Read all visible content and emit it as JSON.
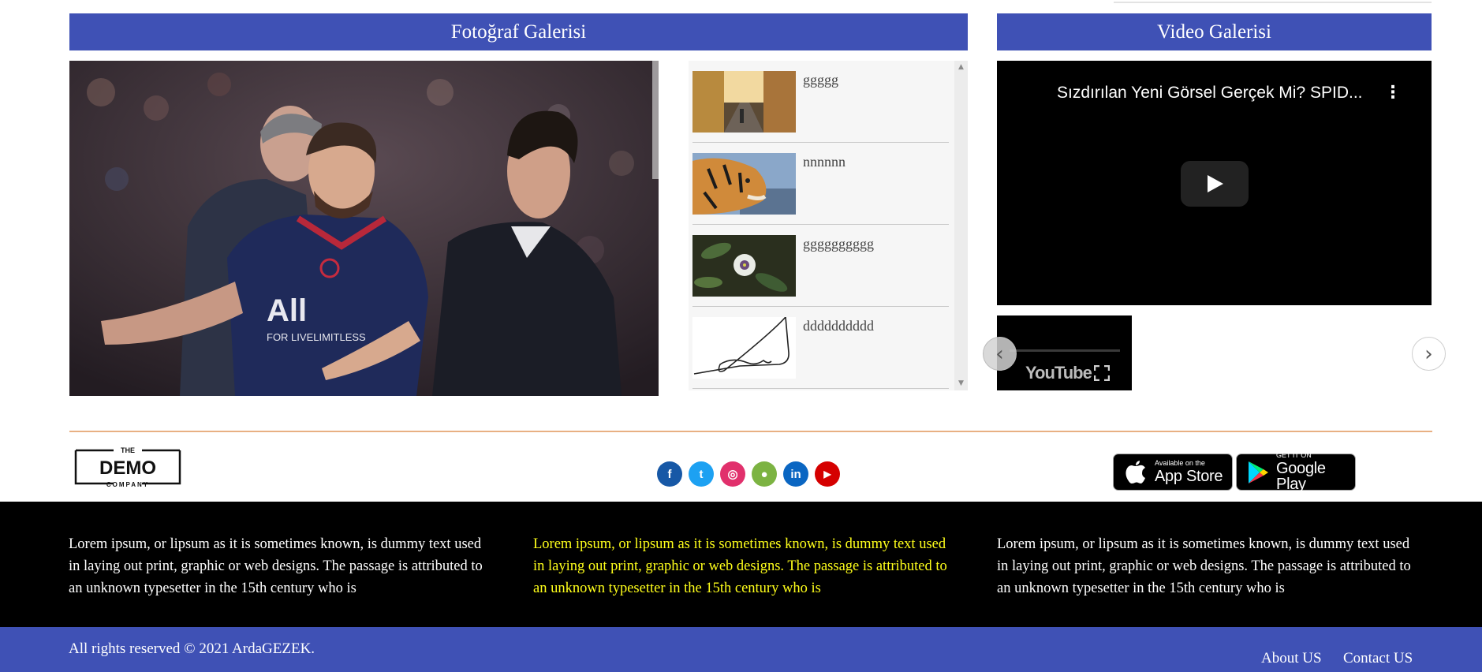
{
  "photo_gallery": {
    "heading": "Fotoğraf Galerisi",
    "thumbnails": [
      {
        "title": "ggggg"
      },
      {
        "title": "nnnnnn"
      },
      {
        "title": "gggggggggg"
      },
      {
        "title": "dddddddddd"
      }
    ],
    "scroll_up": "▲",
    "scroll_down": "▼"
  },
  "video_gallery": {
    "heading": "Video Galerisi",
    "video_title": "Sızdırılan Yeni Görsel Gerçek Mi? SPID...",
    "menu_glyph": "⋮",
    "youtube_label": "YouTube",
    "prev_glyph": "‹",
    "next_glyph": "›"
  },
  "brand": {
    "logo_top": "THE",
    "logo_main": "DEMO",
    "logo_bottom": "COMPANY"
  },
  "social": [
    {
      "name": "facebook",
      "glyph": "f",
      "color": "#1758a6"
    },
    {
      "name": "twitter",
      "glyph": "t",
      "color": "#1da1f2"
    },
    {
      "name": "instagram",
      "glyph": "◎",
      "color": "#e1306c"
    },
    {
      "name": "android",
      "glyph": "●",
      "color": "#7cb342"
    },
    {
      "name": "linkedin",
      "glyph": "in",
      "color": "#0a66c2"
    },
    {
      "name": "youtube",
      "glyph": "▶",
      "color": "#d50000"
    }
  ],
  "stores": {
    "apple_small": "Available on the",
    "apple_big": "App Store",
    "google_small": "GET IT ON",
    "google_big": "Google Play"
  },
  "lorem_columns": [
    "Lorem ipsum, or lipsum as it is sometimes known, is dummy text used in laying out print, graphic or web designs. The passage is attributed to an unknown typesetter in the 15th century who is",
    "Lorem ipsum, or lipsum as it is sometimes known, is dummy text used in laying out print, graphic or web designs. The passage is attributed to an unknown typesetter in the 15th century who is",
    "Lorem ipsum, or lipsum as it is sometimes known, is dummy text used in laying out print, graphic or web designs. The passage is attributed to an unknown typesetter in the 15th century who is"
  ],
  "footer": {
    "copyright": "All rights reserved © 2021 ArdaGEZEK.",
    "about": "About US",
    "contact": "Contact US"
  },
  "colors": {
    "primary": "#3f51b5",
    "accent_text": "#ffff1a",
    "divider": "#e8b083"
  }
}
